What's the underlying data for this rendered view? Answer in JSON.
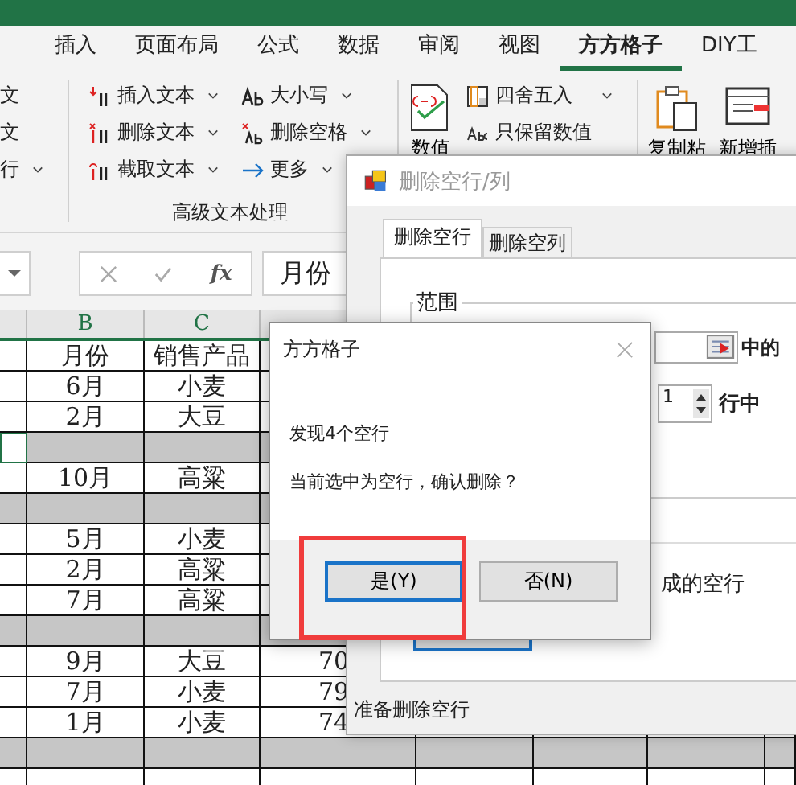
{
  "ribbon_tabs": [
    {
      "label": "插入",
      "selected": false
    },
    {
      "label": "页面布局",
      "selected": false
    },
    {
      "label": "公式",
      "selected": false
    },
    {
      "label": "数据",
      "selected": false
    },
    {
      "label": "审阅",
      "selected": false
    },
    {
      "label": "视图",
      "selected": false
    },
    {
      "label": "方方格子",
      "selected": true
    },
    {
      "label": "DIY工",
      "selected": false
    }
  ],
  "ribbon": {
    "cut_items": [
      {
        "label": "文",
        "dropdown": false
      },
      {
        "label": "文",
        "dropdown": false
      },
      {
        "label": "行",
        "dropdown": true
      }
    ],
    "text_commands": [
      {
        "kind": "insert",
        "label": "插入文本",
        "dropdown": true
      },
      {
        "kind": "delete",
        "label": "删除文本",
        "dropdown": true
      },
      {
        "kind": "extract",
        "label": "截取文本",
        "dropdown": true
      },
      {
        "kind": "case",
        "label": "大小写",
        "dropdown": true
      },
      {
        "kind": "trim",
        "label": "删除空格",
        "dropdown": true
      },
      {
        "kind": "more",
        "label": "更多",
        "dropdown": true
      }
    ],
    "group_label": "高级文本处理",
    "number_button": "数值",
    "number_commands": [
      {
        "kind": "round",
        "label": "四舍五入",
        "dropdown": true
      },
      {
        "kind": "keep",
        "label": "只保留数值",
        "dropdown": false
      }
    ],
    "large_buttons": [
      {
        "kind": "paste",
        "label": "复制粘"
      },
      {
        "kind": "insert-row",
        "label": "新增插"
      }
    ]
  },
  "formula_bar": {
    "function_label": "fx",
    "value": "月份"
  },
  "sheet": {
    "columns": [
      "B",
      "C"
    ],
    "rows": [
      {
        "empty": false,
        "active": false,
        "cells": [
          "月份",
          "销售产品"
        ]
      },
      {
        "empty": false,
        "active": false,
        "cells": [
          "6月",
          "小麦"
        ]
      },
      {
        "empty": false,
        "active": false,
        "cells": [
          "2月",
          "大豆"
        ]
      },
      {
        "empty": true,
        "active": true,
        "cells": []
      },
      {
        "empty": false,
        "active": false,
        "cells": [
          "10月",
          "高粱"
        ]
      },
      {
        "empty": true,
        "active": false,
        "cells": []
      },
      {
        "empty": false,
        "active": false,
        "cells": [
          "5月",
          "小麦"
        ]
      },
      {
        "empty": false,
        "active": false,
        "cells": [
          "2月",
          "高粱"
        ]
      },
      {
        "empty": false,
        "active": false,
        "cells": [
          "7月",
          "高粱"
        ]
      },
      {
        "empty": true,
        "active": false,
        "cells": []
      },
      {
        "empty": false,
        "active": false,
        "cells": [
          "9月",
          "大豆",
          "70"
        ]
      },
      {
        "empty": false,
        "active": false,
        "cells": [
          "7月",
          "小麦",
          "79"
        ]
      },
      {
        "empty": false,
        "active": false,
        "cells": [
          "1月",
          "小麦",
          "74"
        ]
      },
      {
        "empty": true,
        "active": false,
        "cells": []
      }
    ]
  },
  "main_dialog": {
    "title": "删除空行/列",
    "tabs": [
      {
        "label": "删除空行",
        "selected": true
      },
      {
        "label": "删除空列",
        "selected": false
      }
    ],
    "group_label": "范围",
    "range_suffix": "中的",
    "spin_value": "1",
    "spin_suffix": "行中",
    "option_text": "成的空行",
    "status": "准备删除空行"
  },
  "message_box": {
    "title": "方方格子",
    "lines": [
      "发现4个空行",
      "当前选中为空行，确认删除？"
    ],
    "buttons": [
      {
        "label": "是(Y)",
        "default": true
      },
      {
        "label": "否(N)",
        "default": false
      }
    ]
  }
}
